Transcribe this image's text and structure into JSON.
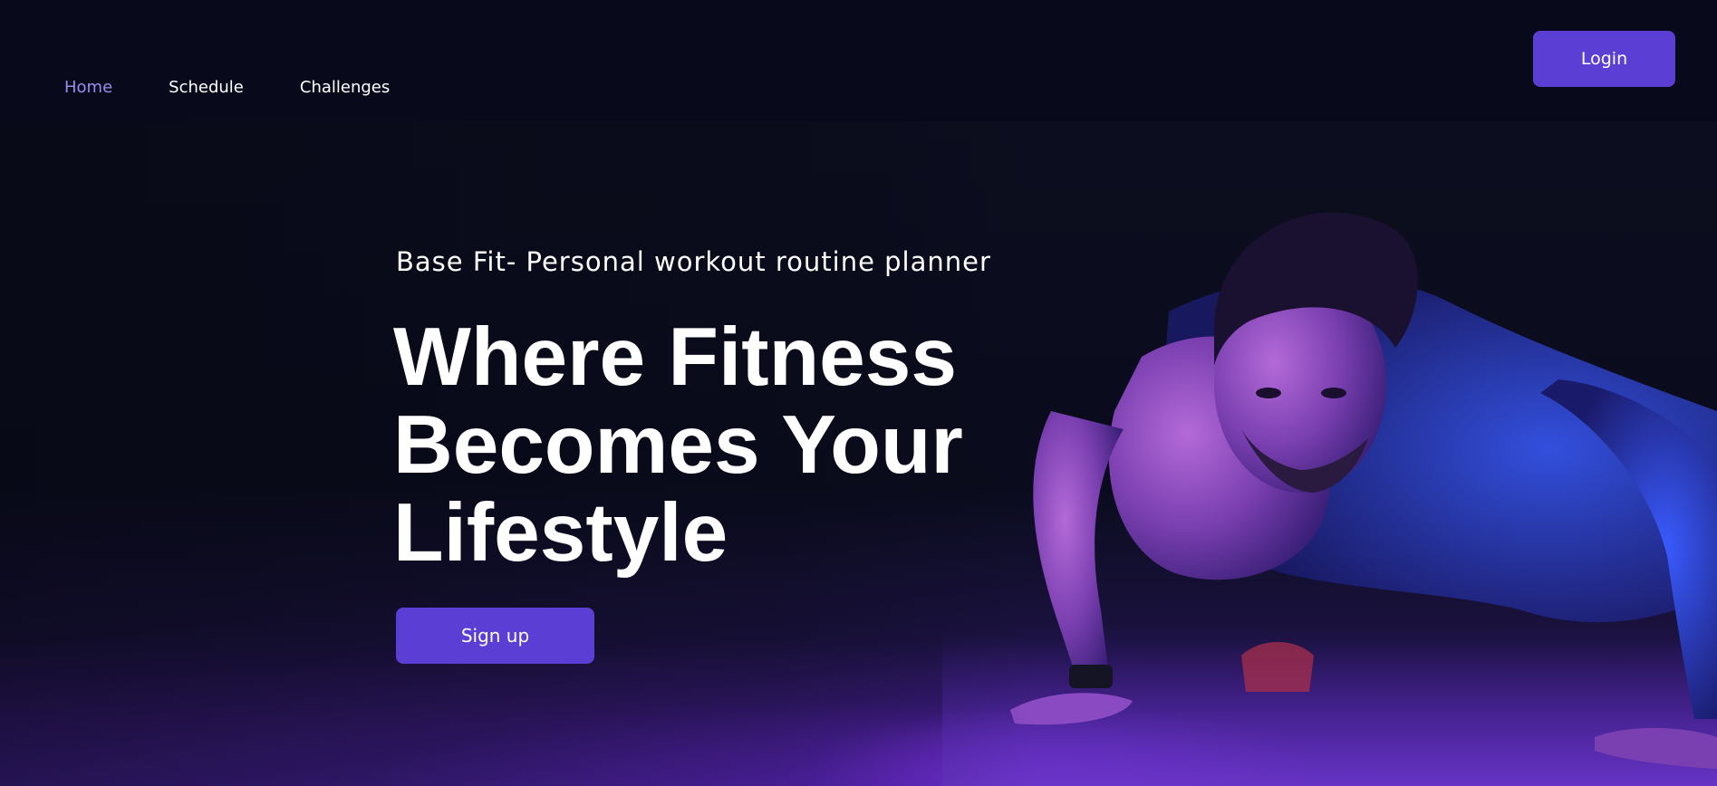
{
  "nav": {
    "items": [
      {
        "label": "Home",
        "active": true
      },
      {
        "label": "Schedule",
        "active": false
      },
      {
        "label": "Challenges",
        "active": false
      }
    ]
  },
  "header": {
    "login_label": "Login"
  },
  "hero": {
    "subtitle": "Base Fit- Personal workout routine planner",
    "headline_lines": [
      "Where Fitness",
      "Becomes Your",
      "Lifestyle"
    ],
    "signup_label": "Sign up",
    "image_icon": "man-doing-pushup-photo"
  },
  "colors": {
    "accent": "#5b3fd4",
    "active_nav": "#9b8cf0",
    "background": "#070818",
    "text": "#ffffff"
  }
}
